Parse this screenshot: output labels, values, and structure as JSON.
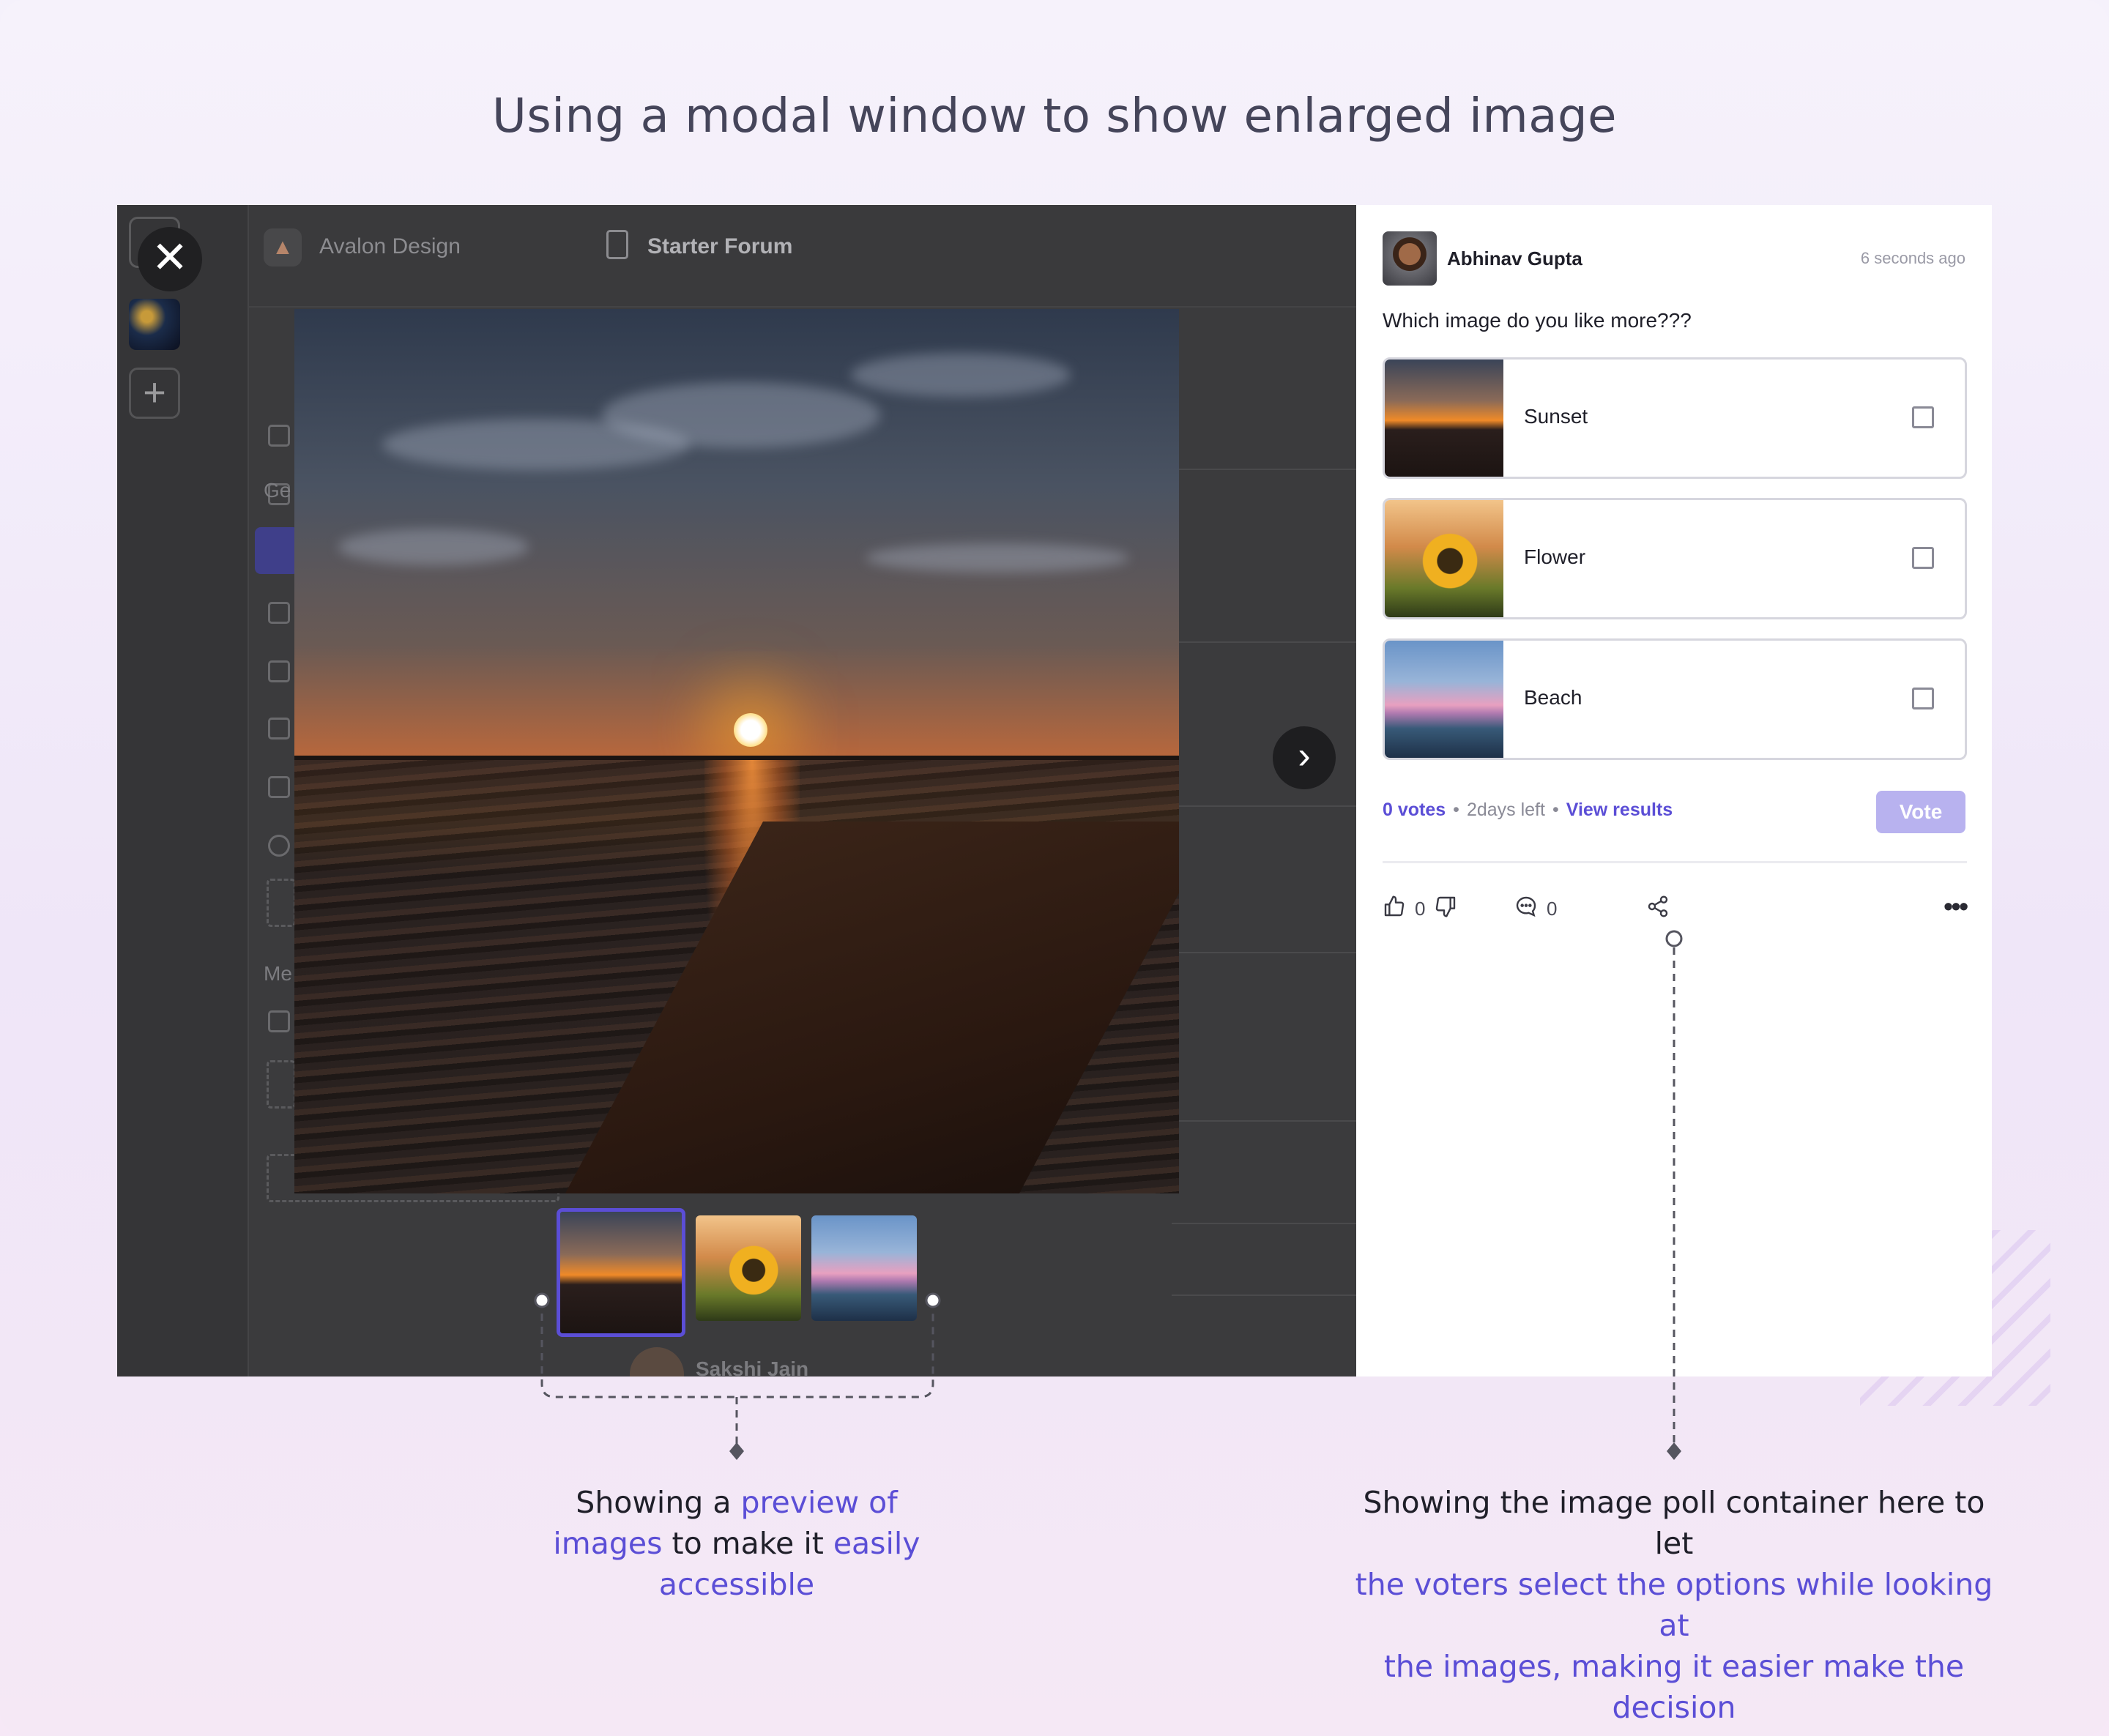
{
  "headline": "Using a modal window to show enlarged image",
  "background_app": {
    "brand": "Avalon Design",
    "forum": "Starter Forum",
    "section_general": "Ge",
    "section_members": "Me",
    "member_name": "Sakshi Jain"
  },
  "modal": {
    "close_icon": "close-icon",
    "next_icon": "chevron-right-icon",
    "thumbnails": [
      {
        "name": "Sunset",
        "active": true
      },
      {
        "name": "Flower",
        "active": false
      },
      {
        "name": "Beach",
        "active": false
      }
    ]
  },
  "poll": {
    "author": "Abhinav Gupta",
    "timestamp": "6 seconds ago",
    "question": "Which image do you like more???",
    "options": [
      {
        "label": "Sunset"
      },
      {
        "label": "Flower"
      },
      {
        "label": "Beach"
      }
    ],
    "votes": "0 votes",
    "time_left": "2days left",
    "view_results": "View results",
    "vote_button": "Vote",
    "likes": "0",
    "comments": "0"
  },
  "annotations": {
    "left": {
      "p1": "Showing a ",
      "h1": "preview of",
      "h2": "images",
      "p2": " to make it ",
      "h3": "easily",
      "h4": "accessible"
    },
    "right": {
      "p1": "Showing the image poll container here to let",
      "h1": "the voters select the options while looking at",
      "h2": "the images, making it easier make the",
      "h3": "decision"
    }
  },
  "colors": {
    "accent": "#5b4ed6",
    "vote_disabled": "#b8b2ef",
    "overlay": "#3a3a3c"
  }
}
